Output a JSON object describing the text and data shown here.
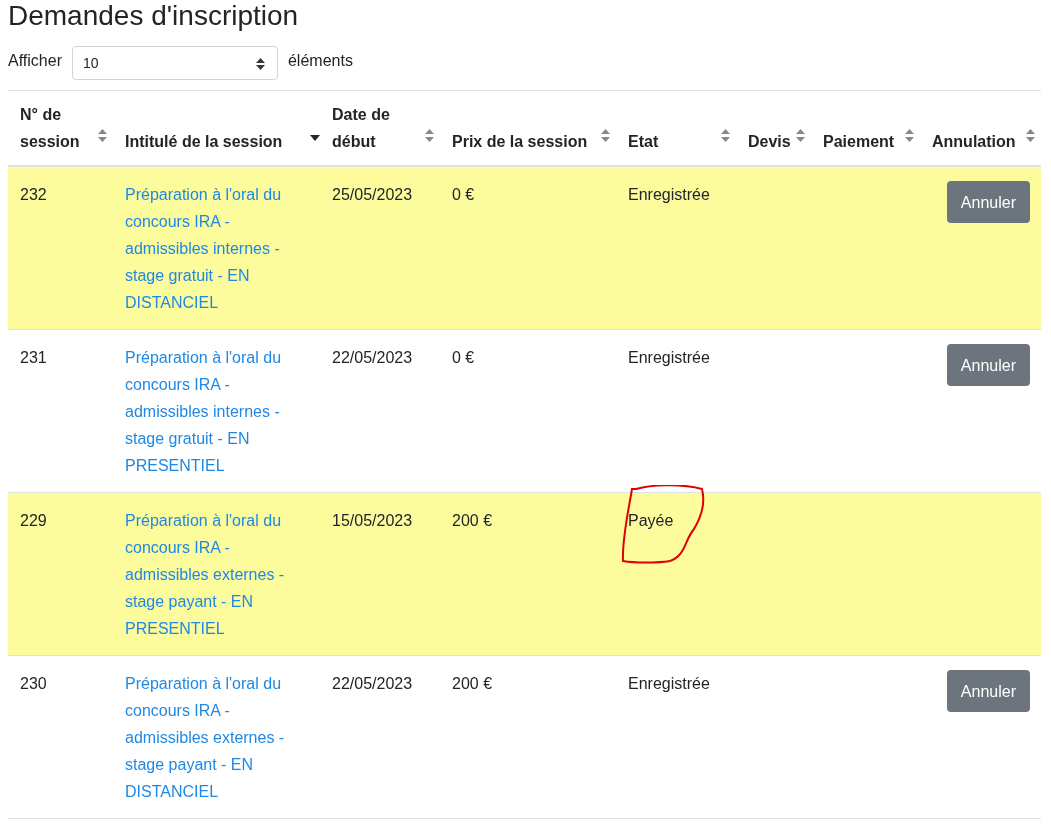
{
  "title": "Demandes d'inscription",
  "length_control": {
    "label": "Afficher",
    "value": "10",
    "suffix": "éléments"
  },
  "table": {
    "columns": [
      {
        "label": "N° de session",
        "sorted": false
      },
      {
        "label": "Intitulé de la session",
        "sorted": true
      },
      {
        "label": "Date de début",
        "sorted": false
      },
      {
        "label": "Prix de la session",
        "sorted": false
      },
      {
        "label": "Etat",
        "sorted": false
      },
      {
        "label": "Devis",
        "sorted": false
      },
      {
        "label": "Paiement",
        "sorted": false
      },
      {
        "label": "Annulation",
        "sorted": false
      }
    ],
    "rows": [
      {
        "highlighted": true,
        "number": "232",
        "title": "Préparation à l'oral du concours IRA - admissibles internes - stage gratuit - EN DISTANCIEL",
        "date": "25/05/2023",
        "price": "0 €",
        "state": "Enregistrée",
        "circled": false,
        "cancel_button": "Annuler"
      },
      {
        "highlighted": false,
        "number": "231",
        "title": "Préparation à l'oral du concours IRA - admissibles internes - stage gratuit - EN PRESENTIEL",
        "date": "22/05/2023",
        "price": "0 €",
        "state": "Enregistrée",
        "circled": false,
        "cancel_button": "Annuler"
      },
      {
        "highlighted": true,
        "number": "229",
        "title": "Préparation à l'oral du concours IRA - admissibles externes - stage payant - EN PRESENTIEL",
        "date": "15/05/2023",
        "price": "200 €",
        "state": "Payée",
        "circled": true
      },
      {
        "highlighted": false,
        "number": "230",
        "title": "Préparation à l'oral du concours IRA - admissibles externes - stage payant - EN DISTANCIEL",
        "date": "22/05/2023",
        "price": "200 €",
        "state": "Enregistrée",
        "circled": false,
        "cancel_button": "Annuler"
      }
    ]
  }
}
